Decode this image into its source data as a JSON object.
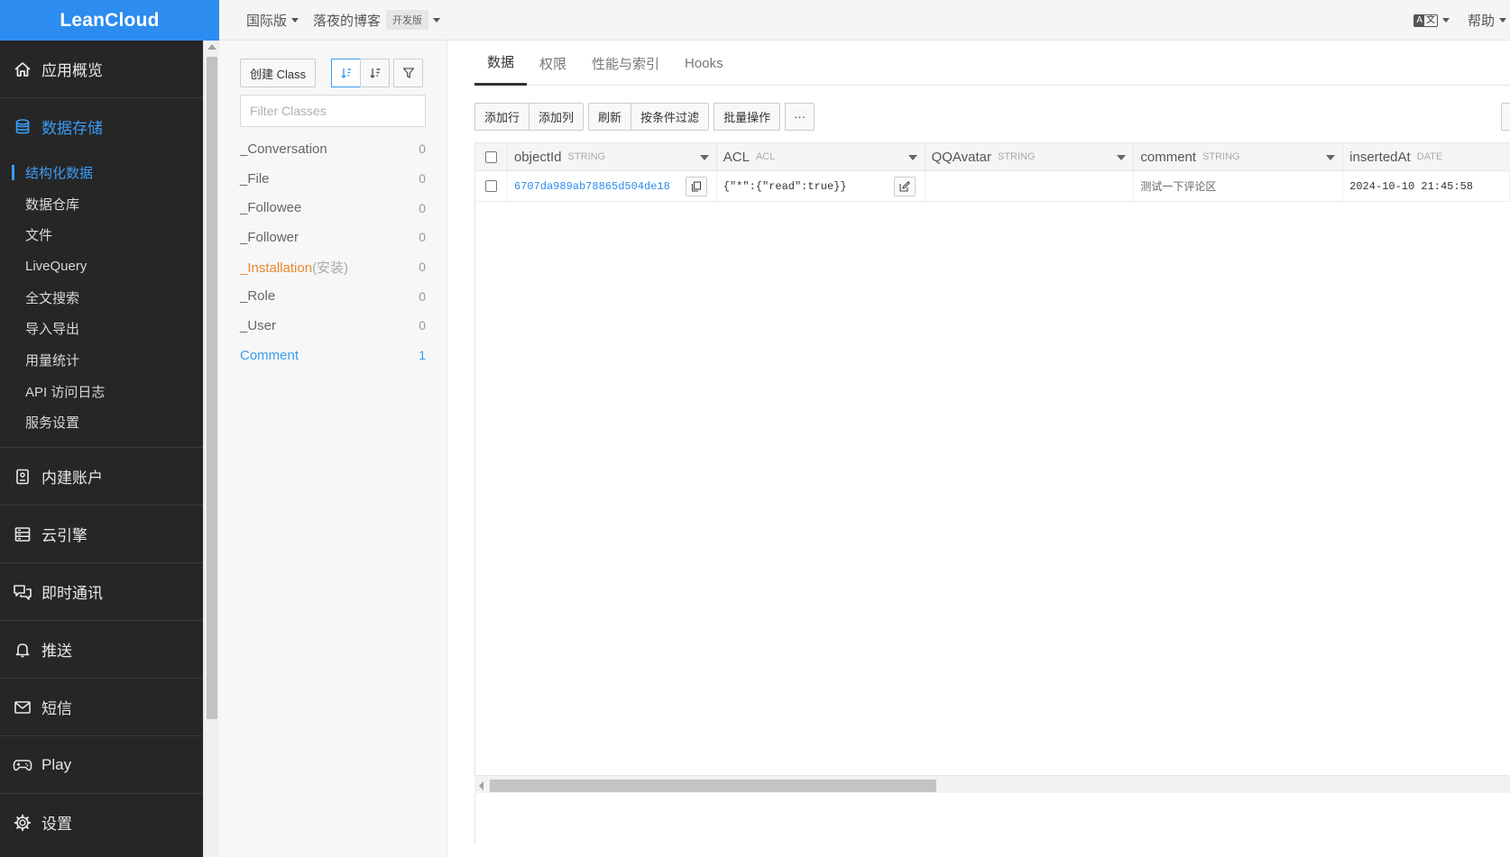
{
  "brand": {
    "name": "LeanCloud",
    "accent": "#2d8cf0"
  },
  "topbar": {
    "region": "国际版",
    "app_name": "落夜的博客",
    "app_badge": "开发版",
    "lang_a": "A",
    "lang_b": "文",
    "help": "帮助"
  },
  "sidebar": {
    "overview": "应用概览",
    "storage": "数据存储",
    "storage_items": [
      "结构化数据",
      "数据仓库",
      "文件",
      "LiveQuery",
      "全文搜索",
      "导入导出",
      "用量统计",
      "API 访问日志",
      "服务设置"
    ],
    "accounts": "内建账户",
    "engine": "云引擎",
    "im": "即时通讯",
    "push": "推送",
    "sms": "短信",
    "play": "Play",
    "settings": "设置"
  },
  "class_panel": {
    "create_button": "创建 Class",
    "filter_placeholder": "Filter Classes",
    "classes": [
      {
        "name": "_Conversation",
        "sub": "",
        "count": "0"
      },
      {
        "name": "_File",
        "sub": "",
        "count": "0"
      },
      {
        "name": "_Followee",
        "sub": "",
        "count": "0"
      },
      {
        "name": "_Follower",
        "sub": "",
        "count": "0"
      },
      {
        "name": "_Installation",
        "sub": "(安装)",
        "count": "0"
      },
      {
        "name": "_Role",
        "sub": "",
        "count": "0"
      },
      {
        "name": "_User",
        "sub": "",
        "count": "0"
      },
      {
        "name": "Comment",
        "sub": "",
        "count": "1"
      }
    ]
  },
  "main": {
    "tabs": [
      "数据",
      "权限",
      "性能与索引",
      "Hooks"
    ],
    "actions": {
      "add_row": "添加行",
      "add_column": "添加列",
      "refresh": "刷新",
      "filter": "按条件过滤",
      "batch": "批量操作",
      "more": "···"
    },
    "columns": [
      {
        "name": "objectId",
        "type": "STRING"
      },
      {
        "name": "ACL",
        "type": "ACL"
      },
      {
        "name": "QQAvatar",
        "type": "STRING"
      },
      {
        "name": "comment",
        "type": "STRING"
      },
      {
        "name": "insertedAt",
        "type": "DATE"
      }
    ],
    "rows": [
      {
        "objectId": "6707da989ab78865d504de18",
        "ACL": "{\"*\":{\"read\":true}}",
        "QQAvatar": "",
        "comment": "测试一下评论区",
        "insertedAt": "2024-10-10 21:45:58"
      }
    ]
  }
}
